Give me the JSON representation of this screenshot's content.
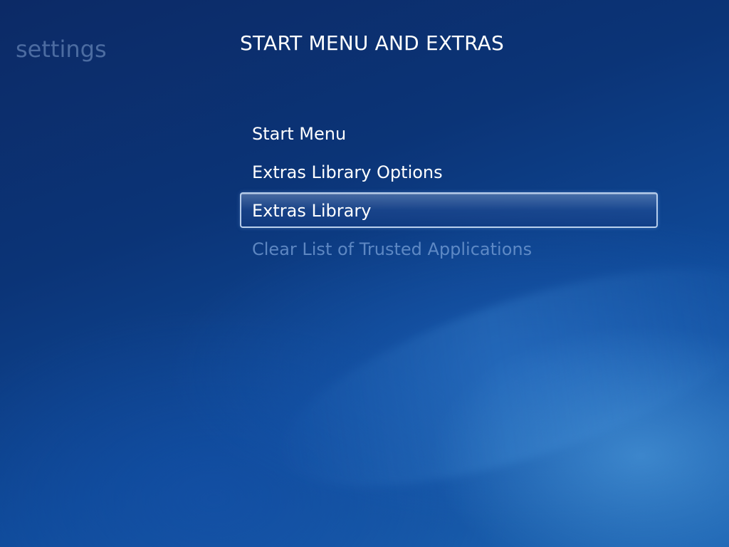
{
  "section_label": "settings",
  "page_title": "START MENU AND EXTRAS",
  "menu": {
    "items": [
      {
        "label": "Start Menu",
        "state": "normal"
      },
      {
        "label": "Extras Library Options",
        "state": "normal"
      },
      {
        "label": "Extras Library",
        "state": "selected"
      },
      {
        "label": "Clear List of Trusted Applications",
        "state": "disabled"
      }
    ]
  },
  "colors": {
    "background_dark": "#0c2a66",
    "background_light": "#1c63b2",
    "text_primary": "#ffffff",
    "text_disabled": "#789fd7",
    "section_label": "#82a0cd"
  }
}
